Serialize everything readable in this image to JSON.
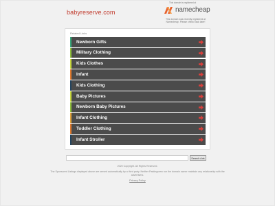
{
  "header": {
    "domain": "babyreserve.com",
    "registrar_caption": "This domain is registered at",
    "registrar_logo_text": "namecheap",
    "registrar_note": "This domain was recently registered at Namecheap. Please check back later!"
  },
  "colors": {
    "domain_text": "#c0392b",
    "namecheap_orange": "#e8612c",
    "row_background": "#4b4b4b",
    "arrow": "#d9403c"
  },
  "related": {
    "title": "Related Links",
    "links": [
      {
        "label": "Newborn Gifts",
        "bar_color": "#37a779"
      },
      {
        "label": "Military Clothing",
        "bar_color": "#8fbf3b"
      },
      {
        "label": "Kids Clothes",
        "bar_color": "#c7d63d"
      },
      {
        "label": "Infant",
        "bar_color": "#e07a2e"
      },
      {
        "label": "Kids Clothing",
        "bar_color": "#24445e"
      },
      {
        "label": "Baby Pictures",
        "bar_color": "#c7d63d"
      },
      {
        "label": "Newborn Baby Pictures",
        "bar_color": "#8fbf3b"
      },
      {
        "label": "Infant Clothing",
        "bar_color": "#e0a23a"
      },
      {
        "label": "Toddler Clothing",
        "bar_color": "#e07a2e"
      },
      {
        "label": "Infant Stroller",
        "bar_color": "#24445e"
      }
    ],
    "arrow_icon": "arrow-right-icon"
  },
  "search": {
    "input_value": "",
    "button_label": "Search Ads"
  },
  "footer": {
    "copyright": "2020 Copyright. All Rights Reserved.",
    "disclaimer": "The Sponsored Listings displayed above are served automatically by a third party. Neither Parkingcrew nor the domain owner maintain any relationship with the advertisers.",
    "privacy_label": "Privacy Policy"
  }
}
